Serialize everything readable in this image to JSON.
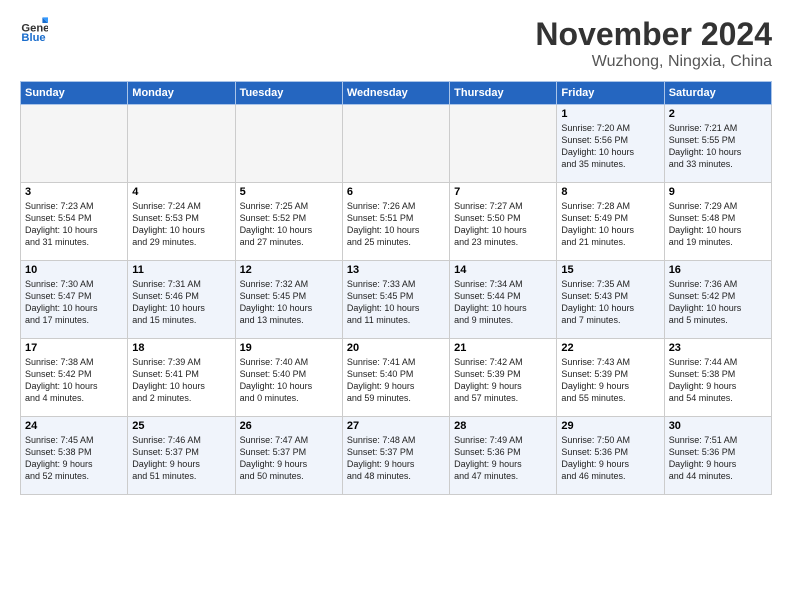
{
  "header": {
    "logo_general": "General",
    "logo_blue": "Blue",
    "month": "November 2024",
    "location": "Wuzhong, Ningxia, China"
  },
  "days_of_week": [
    "Sunday",
    "Monday",
    "Tuesday",
    "Wednesday",
    "Thursday",
    "Friday",
    "Saturday"
  ],
  "weeks": [
    [
      {
        "day": "",
        "info": "",
        "empty": true
      },
      {
        "day": "",
        "info": "",
        "empty": true
      },
      {
        "day": "",
        "info": "",
        "empty": true
      },
      {
        "day": "",
        "info": "",
        "empty": true
      },
      {
        "day": "",
        "info": "",
        "empty": true
      },
      {
        "day": "1",
        "info": "Sunrise: 7:20 AM\nSunset: 5:56 PM\nDaylight: 10 hours\nand 35 minutes.",
        "empty": false
      },
      {
        "day": "2",
        "info": "Sunrise: 7:21 AM\nSunset: 5:55 PM\nDaylight: 10 hours\nand 33 minutes.",
        "empty": false
      }
    ],
    [
      {
        "day": "3",
        "info": "Sunrise: 7:23 AM\nSunset: 5:54 PM\nDaylight: 10 hours\nand 31 minutes.",
        "empty": false
      },
      {
        "day": "4",
        "info": "Sunrise: 7:24 AM\nSunset: 5:53 PM\nDaylight: 10 hours\nand 29 minutes.",
        "empty": false
      },
      {
        "day": "5",
        "info": "Sunrise: 7:25 AM\nSunset: 5:52 PM\nDaylight: 10 hours\nand 27 minutes.",
        "empty": false
      },
      {
        "day": "6",
        "info": "Sunrise: 7:26 AM\nSunset: 5:51 PM\nDaylight: 10 hours\nand 25 minutes.",
        "empty": false
      },
      {
        "day": "7",
        "info": "Sunrise: 7:27 AM\nSunset: 5:50 PM\nDaylight: 10 hours\nand 23 minutes.",
        "empty": false
      },
      {
        "day": "8",
        "info": "Sunrise: 7:28 AM\nSunset: 5:49 PM\nDaylight: 10 hours\nand 21 minutes.",
        "empty": false
      },
      {
        "day": "9",
        "info": "Sunrise: 7:29 AM\nSunset: 5:48 PM\nDaylight: 10 hours\nand 19 minutes.",
        "empty": false
      }
    ],
    [
      {
        "day": "10",
        "info": "Sunrise: 7:30 AM\nSunset: 5:47 PM\nDaylight: 10 hours\nand 17 minutes.",
        "empty": false
      },
      {
        "day": "11",
        "info": "Sunrise: 7:31 AM\nSunset: 5:46 PM\nDaylight: 10 hours\nand 15 minutes.",
        "empty": false
      },
      {
        "day": "12",
        "info": "Sunrise: 7:32 AM\nSunset: 5:45 PM\nDaylight: 10 hours\nand 13 minutes.",
        "empty": false
      },
      {
        "day": "13",
        "info": "Sunrise: 7:33 AM\nSunset: 5:45 PM\nDaylight: 10 hours\nand 11 minutes.",
        "empty": false
      },
      {
        "day": "14",
        "info": "Sunrise: 7:34 AM\nSunset: 5:44 PM\nDaylight: 10 hours\nand 9 minutes.",
        "empty": false
      },
      {
        "day": "15",
        "info": "Sunrise: 7:35 AM\nSunset: 5:43 PM\nDaylight: 10 hours\nand 7 minutes.",
        "empty": false
      },
      {
        "day": "16",
        "info": "Sunrise: 7:36 AM\nSunset: 5:42 PM\nDaylight: 10 hours\nand 5 minutes.",
        "empty": false
      }
    ],
    [
      {
        "day": "17",
        "info": "Sunrise: 7:38 AM\nSunset: 5:42 PM\nDaylight: 10 hours\nand 4 minutes.",
        "empty": false
      },
      {
        "day": "18",
        "info": "Sunrise: 7:39 AM\nSunset: 5:41 PM\nDaylight: 10 hours\nand 2 minutes.",
        "empty": false
      },
      {
        "day": "19",
        "info": "Sunrise: 7:40 AM\nSunset: 5:40 PM\nDaylight: 10 hours\nand 0 minutes.",
        "empty": false
      },
      {
        "day": "20",
        "info": "Sunrise: 7:41 AM\nSunset: 5:40 PM\nDaylight: 9 hours\nand 59 minutes.",
        "empty": false
      },
      {
        "day": "21",
        "info": "Sunrise: 7:42 AM\nSunset: 5:39 PM\nDaylight: 9 hours\nand 57 minutes.",
        "empty": false
      },
      {
        "day": "22",
        "info": "Sunrise: 7:43 AM\nSunset: 5:39 PM\nDaylight: 9 hours\nand 55 minutes.",
        "empty": false
      },
      {
        "day": "23",
        "info": "Sunrise: 7:44 AM\nSunset: 5:38 PM\nDaylight: 9 hours\nand 54 minutes.",
        "empty": false
      }
    ],
    [
      {
        "day": "24",
        "info": "Sunrise: 7:45 AM\nSunset: 5:38 PM\nDaylight: 9 hours\nand 52 minutes.",
        "empty": false
      },
      {
        "day": "25",
        "info": "Sunrise: 7:46 AM\nSunset: 5:37 PM\nDaylight: 9 hours\nand 51 minutes.",
        "empty": false
      },
      {
        "day": "26",
        "info": "Sunrise: 7:47 AM\nSunset: 5:37 PM\nDaylight: 9 hours\nand 50 minutes.",
        "empty": false
      },
      {
        "day": "27",
        "info": "Sunrise: 7:48 AM\nSunset: 5:37 PM\nDaylight: 9 hours\nand 48 minutes.",
        "empty": false
      },
      {
        "day": "28",
        "info": "Sunrise: 7:49 AM\nSunset: 5:36 PM\nDaylight: 9 hours\nand 47 minutes.",
        "empty": false
      },
      {
        "day": "29",
        "info": "Sunrise: 7:50 AM\nSunset: 5:36 PM\nDaylight: 9 hours\nand 46 minutes.",
        "empty": false
      },
      {
        "day": "30",
        "info": "Sunrise: 7:51 AM\nSunset: 5:36 PM\nDaylight: 9 hours\nand 44 minutes.",
        "empty": false
      }
    ]
  ]
}
